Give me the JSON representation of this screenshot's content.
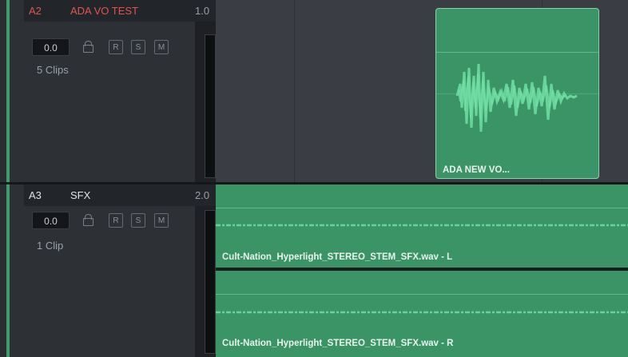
{
  "tracks": [
    {
      "id": "A2",
      "name": "ADA VO TEST",
      "volume_label": "1.0",
      "level": "0.0",
      "buttons": [
        "R",
        "S",
        "M"
      ],
      "clip_count": "5 Clips",
      "id_color": "#e0564f",
      "name_color": "#e0564f"
    },
    {
      "id": "A3",
      "name": "SFX",
      "volume_label": "2.0",
      "level": "0.0",
      "buttons": [
        "R",
        "S",
        "M"
      ],
      "clip_count": "1 Clip",
      "id_color": "#dfe2e6",
      "name_color": "#dfe2e6"
    }
  ],
  "clips": {
    "ada_vo": "ADA NEW VO...",
    "sfx_left": "Cult-Nation_Hyperlight_STEREO_STEM_SFX.wav - L",
    "sfx_right": "Cult-Nation_Hyperlight_STEREO_STEM_SFX.wav - R"
  },
  "colors": {
    "clip_green": "#3a9466",
    "waveform": "#67d59b",
    "track_accent": "#3f9c6c"
  }
}
